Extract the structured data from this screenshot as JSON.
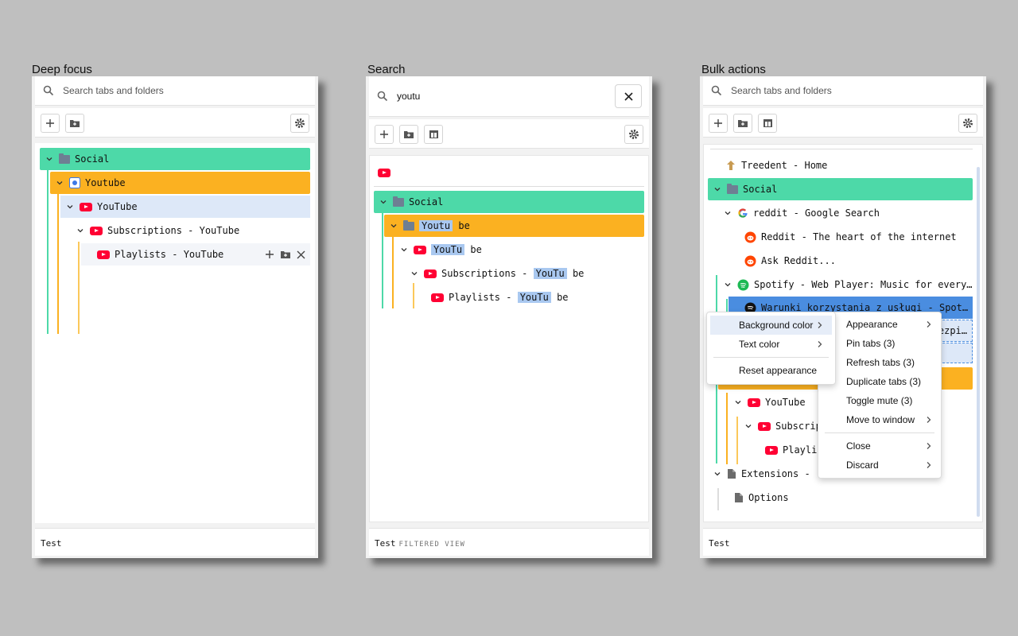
{
  "captions": [
    "Deep focus",
    "Search",
    "Bulk actions"
  ],
  "search": {
    "placeholder": "Search tabs and folders",
    "query": "youtu"
  },
  "footer": {
    "label": "Test",
    "filtered_label": "FILTERED VIEW"
  },
  "panel1": {
    "rows": [
      "Social",
      "Youtube",
      "YouTube",
      "Subscriptions - YouTube",
      "Playlists - YouTube"
    ]
  },
  "panel2": {
    "social": "Social",
    "r1": {
      "a": "Youtu",
      "b": "be"
    },
    "r2": {
      "a": "YouTu",
      "b": "be"
    },
    "r3": {
      "pre": "Subscriptions - ",
      "a": "YouTu",
      "b": "be"
    },
    "r4": {
      "pre": "Playlists - ",
      "a": "YouTu",
      "b": "be"
    }
  },
  "panel3": {
    "rows": [
      "Treedent - Home",
      "Social",
      "reddit - Google Search",
      "Reddit - The heart of the internet",
      "Ask Reddit...",
      "Spotify - Web Player: Music for every…",
      "Warunki korzystania z usługi - Spot…",
      "ezpi…",
      "YouTube",
      "Subscrip",
      "Playli",
      "Extensions - ",
      "Options"
    ]
  },
  "menu_left": [
    "Background color",
    "Text color",
    "Reset appearance"
  ],
  "menu_right": [
    "Appearance",
    "Pin tabs (3)",
    "Refresh tabs (3)",
    "Duplicate tabs (3)",
    "Toggle mute (3)",
    "Move to window",
    "Close",
    "Discard"
  ],
  "colors": {
    "green": "#4dd9a8",
    "orange": "#fbb121",
    "blue_row": "#dde8f8",
    "selected": "#4a8de0",
    "highlight": "#a9c8f0",
    "youtube": "#ff0033"
  }
}
